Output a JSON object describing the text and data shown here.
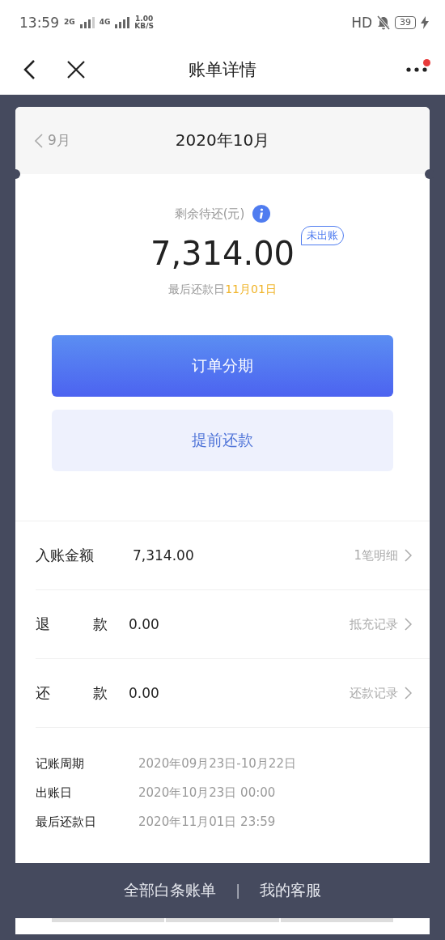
{
  "status_bar": {
    "time": "13:59",
    "network_1": "2G",
    "network_2": "4G",
    "speed": "1.00",
    "speed_unit": "KB/S",
    "hd": "HD",
    "battery": "39"
  },
  "nav": {
    "title": "账单详情",
    "notification": true
  },
  "month_header": {
    "previous": "9月",
    "current": "2020年10月"
  },
  "summary": {
    "label": "剩余待还(元)",
    "amount": "7,314.00",
    "badge": "未出账",
    "due_label": "最后还款日",
    "due_date": "11月01日"
  },
  "buttons": [
    {
      "label": "订单分期",
      "kind": "primary"
    },
    {
      "label": "提前还款",
      "kind": "secondary"
    }
  ],
  "entries": [
    {
      "label": [
        "入账金额"
      ],
      "value": "7,314.00",
      "link": "1笔明细"
    },
    {
      "label": [
        "退",
        "款"
      ],
      "value": "0.00",
      "link": "抵充记录"
    },
    {
      "label": [
        "还",
        "款"
      ],
      "value": "0.00",
      "link": "还款记录"
    }
  ],
  "details": [
    {
      "label": "记账周期",
      "value": "2020年09月23日-10月22日"
    },
    {
      "label": "出账日",
      "value": "2020年10月23日 00:00"
    },
    {
      "label": "最后还款日",
      "value": "2020年11月01日 23:59"
    }
  ],
  "footer_links": [
    {
      "label": "全部白条账单",
      "kind": "link"
    },
    {
      "label": "|",
      "kind": "separator"
    },
    {
      "label": "我的客服",
      "kind": "link"
    }
  ]
}
